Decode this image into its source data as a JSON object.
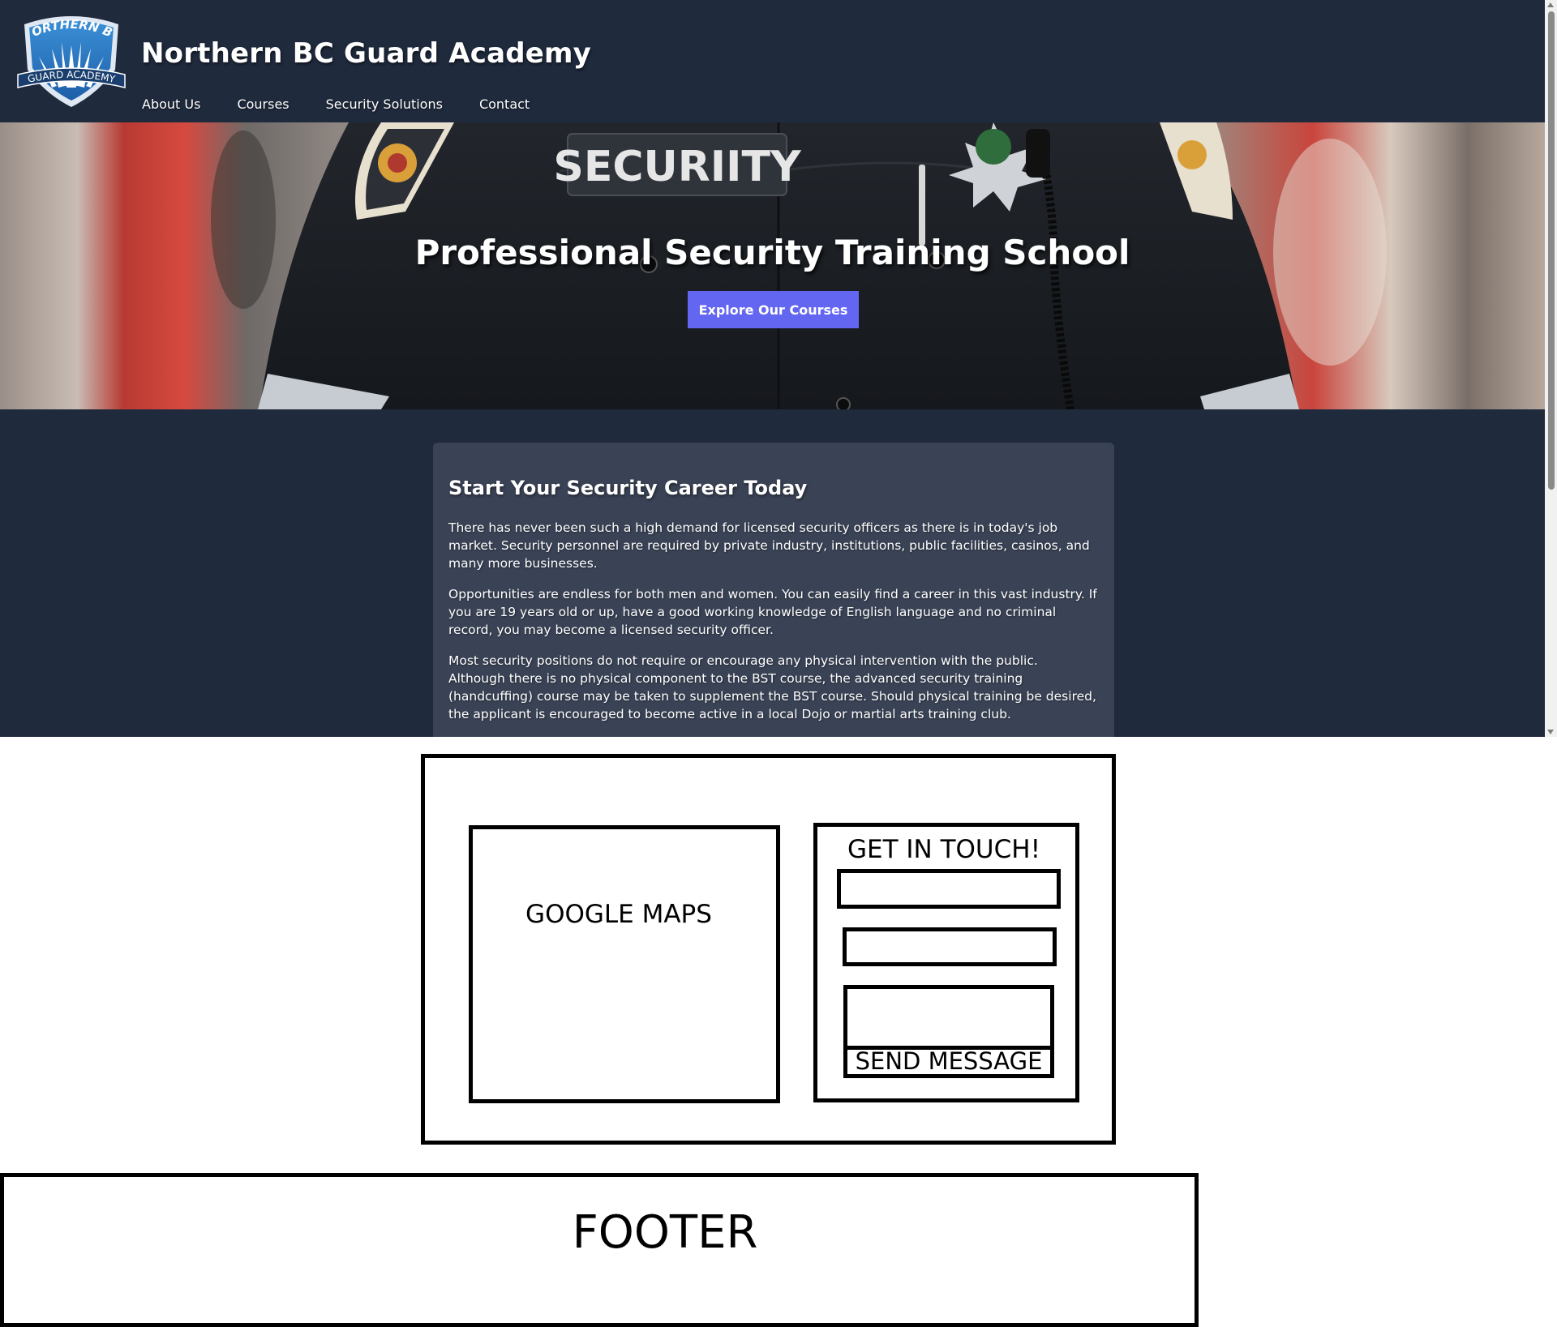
{
  "header": {
    "logo_top": "NORTHERN BC",
    "logo_bottom": "GUARD ACADEMY",
    "site_title": "Northern BC Guard Academy",
    "nav": [
      "About Us",
      "Courses",
      "Security Solutions",
      "Contact"
    ]
  },
  "hero": {
    "patch_text": "SECURIITY",
    "title": "Professional Security Training School",
    "button_label": "Explore Our Courses"
  },
  "intro": {
    "heading": "Start Your Security Career Today",
    "paragraphs": [
      "There has never been such a high demand for licensed security officers as there is in today's job market. Security personnel are required by private industry, institutions, public facilities, casinos, and many more businesses.",
      "Opportunities are endless for both men and women. You can easily find a career in this vast industry. If you are 19 years old or up, have a good working knowledge of English language and no criminal record, you may become a licensed security officer.",
      "Most security positions do not require or encourage any physical intervention with the public. Although there is no physical component to the BST course, the advanced security training (handcuffing) course may be taken to supplement the BST course. Should physical training be desired, the applicant is encouraged to become active in a local Dojo or martial arts training club."
    ]
  },
  "wireframe": {
    "map_label": "GOOGLE MAPS",
    "contact_title": "GET IN TOUCH!",
    "send_label": "SEND MESSAGE",
    "footer_label": "FOOTER"
  },
  "colors": {
    "header_bg": "#1f2a3d",
    "card_bg": "#3a4356",
    "accent": "#6366f1"
  }
}
